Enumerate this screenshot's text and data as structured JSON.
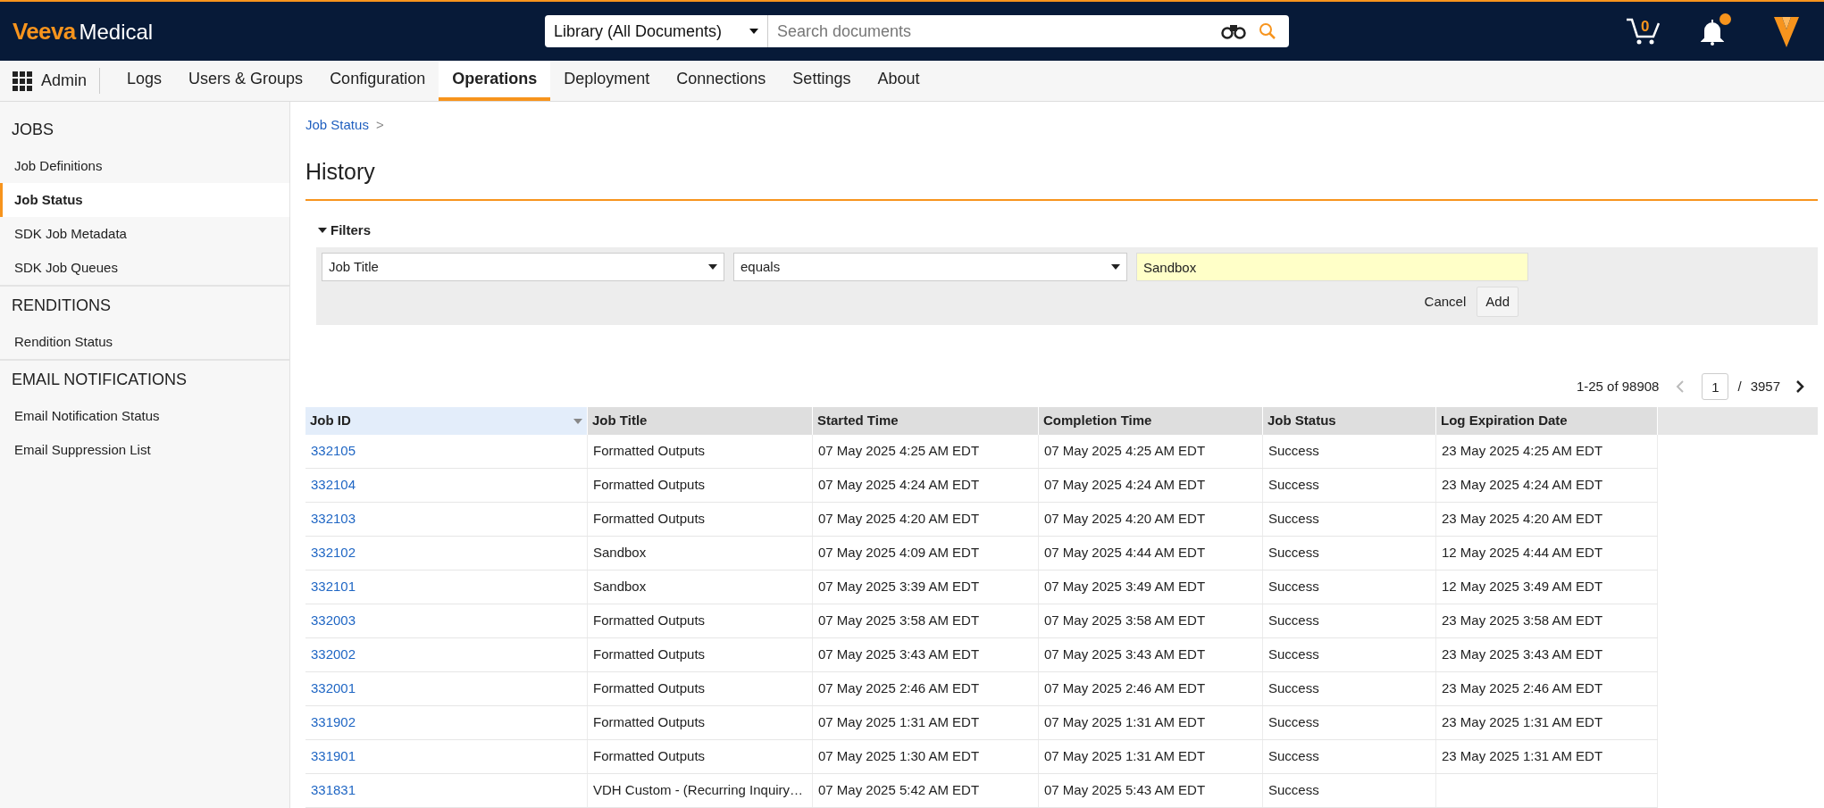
{
  "header": {
    "logo_brand": "Veeva",
    "logo_product": "Medical",
    "search_scope": "Library (All Documents)",
    "search": {
      "placeholder": "Search documents"
    },
    "cart_count": "0",
    "notifications_unread": true
  },
  "nav": {
    "app_label": "Admin",
    "tabs": [
      {
        "label": "Logs",
        "selected": false
      },
      {
        "label": "Users & Groups",
        "selected": false
      },
      {
        "label": "Configuration",
        "selected": false
      },
      {
        "label": "Operations",
        "selected": true
      },
      {
        "label": "Deployment",
        "selected": false
      },
      {
        "label": "Connections",
        "selected": false
      },
      {
        "label": "Settings",
        "selected": false
      },
      {
        "label": "About",
        "selected": false
      }
    ]
  },
  "sidebar": {
    "sections": [
      {
        "title": "JOBS",
        "items": [
          {
            "label": "Job Definitions",
            "selected": false
          },
          {
            "label": "Job Status",
            "selected": true
          },
          {
            "label": "SDK Job Metadata",
            "selected": false
          },
          {
            "label": "SDK Job Queues",
            "selected": false
          }
        ]
      },
      {
        "title": "RENDITIONS",
        "items": [
          {
            "label": "Rendition Status",
            "selected": false
          }
        ]
      },
      {
        "title": "EMAIL NOTIFICATIONS",
        "items": [
          {
            "label": "Email Notification Status",
            "selected": false
          },
          {
            "label": "Email Suppression List",
            "selected": false
          }
        ]
      }
    ]
  },
  "breadcrumb": {
    "link": "Job Status",
    "separator": ">"
  },
  "page_title": "History",
  "filters": {
    "label": "Filters",
    "expanded": true,
    "field": "Job Title",
    "operator": "equals",
    "value": "Sandbox",
    "cancel": "Cancel",
    "add": "Add"
  },
  "pagination": {
    "range": "1-25 of 98908",
    "page": "1",
    "separator": "/",
    "total_pages": "3957",
    "prev_disabled": true
  },
  "table": {
    "columns": [
      {
        "label": "Job ID",
        "sorted": true
      },
      {
        "label": "Job Title",
        "sorted": false
      },
      {
        "label": "Started Time",
        "sorted": false
      },
      {
        "label": "Completion Time",
        "sorted": false
      },
      {
        "label": "Job Status",
        "sorted": false
      },
      {
        "label": "Log Expiration Date",
        "sorted": false
      }
    ],
    "rows": [
      {
        "cells": [
          "332105",
          "Formatted Outputs",
          "07 May 2025 4:25 AM EDT",
          "07 May 2025 4:25 AM EDT",
          "Success",
          "23 May 2025 4:25 AM EDT"
        ]
      },
      {
        "cells": [
          "332104",
          "Formatted Outputs",
          "07 May 2025 4:24 AM EDT",
          "07 May 2025 4:24 AM EDT",
          "Success",
          "23 May 2025 4:24 AM EDT"
        ]
      },
      {
        "cells": [
          "332103",
          "Formatted Outputs",
          "07 May 2025 4:20 AM EDT",
          "07 May 2025 4:20 AM EDT",
          "Success",
          "23 May 2025 4:20 AM EDT"
        ]
      },
      {
        "cells": [
          "332102",
          "Sandbox",
          "07 May 2025 4:09 AM EDT",
          "07 May 2025 4:44 AM EDT",
          "Success",
          "12 May 2025 4:44 AM EDT"
        ]
      },
      {
        "cells": [
          "332101",
          "Sandbox",
          "07 May 2025 3:39 AM EDT",
          "07 May 2025 3:49 AM EDT",
          "Success",
          "12 May 2025 3:49 AM EDT"
        ]
      },
      {
        "cells": [
          "332003",
          "Formatted Outputs",
          "07 May 2025 3:58 AM EDT",
          "07 May 2025 3:58 AM EDT",
          "Success",
          "23 May 2025 3:58 AM EDT"
        ]
      },
      {
        "cells": [
          "332002",
          "Formatted Outputs",
          "07 May 2025 3:43 AM EDT",
          "07 May 2025 3:43 AM EDT",
          "Success",
          "23 May 2025 3:43 AM EDT"
        ]
      },
      {
        "cells": [
          "332001",
          "Formatted Outputs",
          "07 May 2025 2:46 AM EDT",
          "07 May 2025 2:46 AM EDT",
          "Success",
          "23 May 2025 2:46 AM EDT"
        ]
      },
      {
        "cells": [
          "331902",
          "Formatted Outputs",
          "07 May 2025 1:31 AM EDT",
          "07 May 2025 1:31 AM EDT",
          "Success",
          "23 May 2025 1:31 AM EDT"
        ]
      },
      {
        "cells": [
          "331901",
          "Formatted Outputs",
          "07 May 2025 1:30 AM EDT",
          "07 May 2025 1:31 AM EDT",
          "Success",
          "23 May 2025 1:31 AM EDT"
        ]
      },
      {
        "cells": [
          "331831",
          "VDH Custom - (Recurring Inquiry…",
          "07 May 2025 5:42 AM EDT",
          "07 May 2025 5:43 AM EDT",
          "Success"
        ]
      }
    ]
  }
}
